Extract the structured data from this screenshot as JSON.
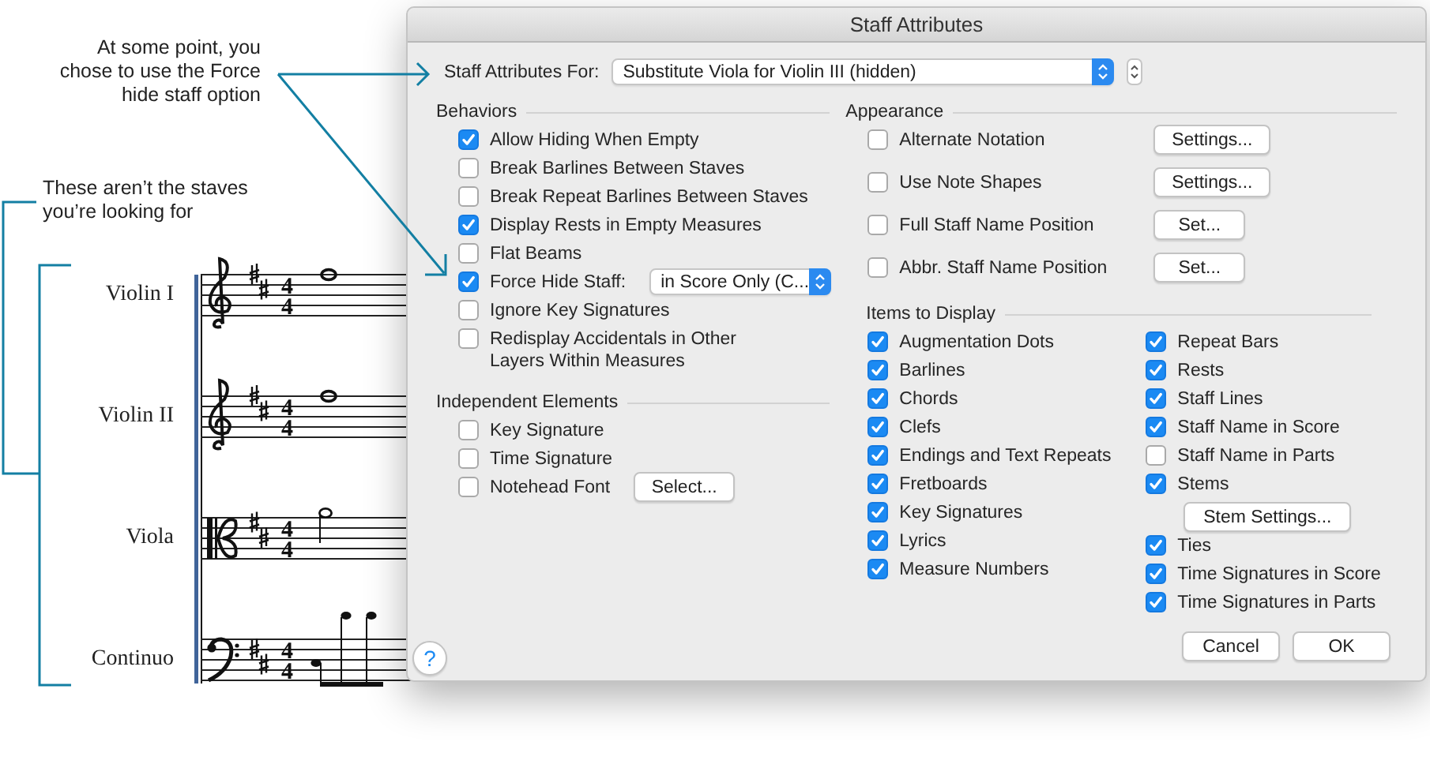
{
  "annotations": [
    {
      "text": "At some point, you\nchose to use the Force\nhide staff option"
    },
    {
      "text": "These aren’t the staves\nyou’re looking for"
    }
  ],
  "score": {
    "staves": [
      {
        "name": "Violin I",
        "clef": {
          "kind": "treble"
        },
        "time_signature": [
          "4",
          "4"
        ],
        "note": {
          "kind": "whole"
        }
      },
      {
        "name": "Violin II",
        "clef": {
          "kind": "treble"
        },
        "time_signature": [
          "4",
          "4"
        ],
        "note": {
          "kind": "whole"
        }
      },
      {
        "name": "Viola",
        "clef": {
          "kind": "alto"
        },
        "time_signature": [
          "4",
          "4"
        ],
        "note": {
          "kind": "half"
        }
      },
      {
        "name": "Continuo",
        "clef": {
          "kind": "bass"
        },
        "time_signature": [
          "4",
          "4"
        ],
        "note": {
          "kind": "eighths"
        }
      }
    ]
  },
  "dialog": {
    "title": "Staff Attributes",
    "staff_selector": {
      "label": "Staff Attributes For:",
      "value": "Substitute Viola for Violin III (hidden)"
    },
    "behaviors": {
      "title": "Behaviors",
      "options": [
        {
          "label": "Allow Hiding When Empty",
          "checked": true
        },
        {
          "label": "Break Barlines Between Staves",
          "checked": false
        },
        {
          "label": "Break Repeat Barlines Between Staves",
          "checked": false
        },
        {
          "label": "Display Rests in Empty Measures",
          "checked": true
        },
        {
          "label": "Flat Beams",
          "checked": false
        },
        {
          "label": "Force Hide Staff:",
          "checked": true,
          "popup": "in Score Only (C..."
        },
        {
          "label": "Ignore Key Signatures",
          "checked": false
        },
        {
          "label": "Redisplay Accidentals in Other\nLayers Within Measures",
          "checked": false
        }
      ]
    },
    "independent_elements": {
      "title": "Independent Elements",
      "options": [
        {
          "label": "Key Signature",
          "checked": false
        },
        {
          "label": "Time Signature",
          "checked": false
        },
        {
          "label": "Notehead Font",
          "checked": false,
          "button": "Select..."
        }
      ]
    },
    "appearance": {
      "title": "Appearance",
      "options": [
        {
          "label": "Alternate Notation",
          "checked": false,
          "button": "Settings..."
        },
        {
          "label": "Use Note Shapes",
          "checked": false,
          "button": "Settings..."
        },
        {
          "label": "Full Staff Name Position",
          "checked": false,
          "button": "Set..."
        },
        {
          "label": "Abbr. Staff Name Position",
          "checked": false,
          "button": "Set..."
        }
      ]
    },
    "items_to_display": {
      "title": "Items to Display",
      "columns": [
        [
          {
            "kind": "checkbox",
            "label": "Augmentation Dots",
            "checked": true
          },
          {
            "kind": "checkbox",
            "label": "Barlines",
            "checked": true
          },
          {
            "kind": "checkbox",
            "label": "Chords",
            "checked": true
          },
          {
            "kind": "checkbox",
            "label": "Clefs",
            "checked": true
          },
          {
            "kind": "checkbox",
            "label": "Endings and Text Repeats",
            "checked": true
          },
          {
            "kind": "checkbox",
            "label": "Fretboards",
            "checked": true
          },
          {
            "kind": "checkbox",
            "label": "Key Signatures",
            "checked": true
          },
          {
            "kind": "checkbox",
            "label": "Lyrics",
            "checked": true
          },
          {
            "kind": "checkbox",
            "label": "Measure Numbers",
            "checked": true
          }
        ],
        [
          {
            "kind": "checkbox",
            "label": "Repeat Bars",
            "checked": true
          },
          {
            "kind": "checkbox",
            "label": "Rests",
            "checked": true
          },
          {
            "kind": "checkbox",
            "label": "Staff Lines",
            "checked": true
          },
          {
            "kind": "checkbox",
            "label": "Staff Name in Score",
            "checked": true
          },
          {
            "kind": "checkbox",
            "label": "Staff Name in Parts",
            "checked": false
          },
          {
            "kind": "checkbox",
            "label": "Stems",
            "checked": true
          },
          {
            "kind": "button",
            "label": "Stem Settings..."
          },
          {
            "kind": "checkbox",
            "label": "Ties",
            "checked": true
          },
          {
            "kind": "checkbox",
            "label": "Time Signatures in Score",
            "checked": true
          },
          {
            "kind": "checkbox",
            "label": "Time Signatures in Parts",
            "checked": true
          }
        ]
      ]
    },
    "help_button": "?",
    "buttons": [
      "Cancel",
      "OK"
    ]
  }
}
